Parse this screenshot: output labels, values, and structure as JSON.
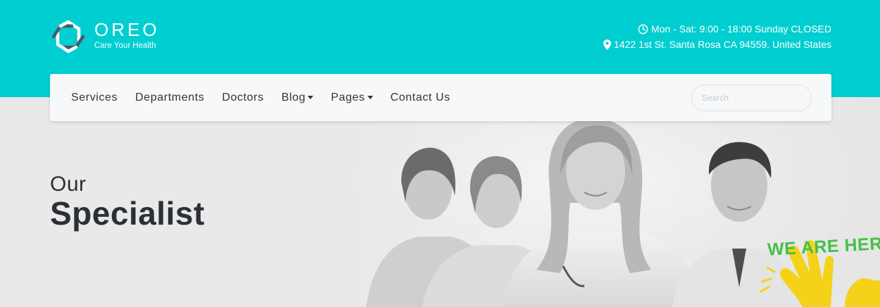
{
  "brand": {
    "name": "OREO",
    "tagline": "Care Your Health"
  },
  "contact": {
    "hours": "Mon - Sat: 9:00 - 18:00 Sunday CLOSED",
    "address": "1422 1st St. Santa Rosa CA 94559. United States",
    "hours_icon": "clock-icon",
    "address_icon": "map-pin-icon"
  },
  "nav": {
    "items": [
      {
        "label": "Services",
        "dropdown": false
      },
      {
        "label": "Departments",
        "dropdown": false
      },
      {
        "label": "Doctors",
        "dropdown": false
      },
      {
        "label": "Blog",
        "dropdown": true
      },
      {
        "label": "Pages",
        "dropdown": true
      },
      {
        "label": "Contact Us",
        "dropdown": false
      }
    ],
    "search_placeholder": "Search"
  },
  "hero": {
    "pre_title": "Our",
    "title": "Specialist",
    "badge": "WE ARE HERE"
  },
  "colors": {
    "header_bg": "#00ced1",
    "nav_bg": "#f7f8f9",
    "title_text": "#2b3035",
    "badge_green": "#45c04a",
    "hand_yellow": "#f5d21a"
  }
}
